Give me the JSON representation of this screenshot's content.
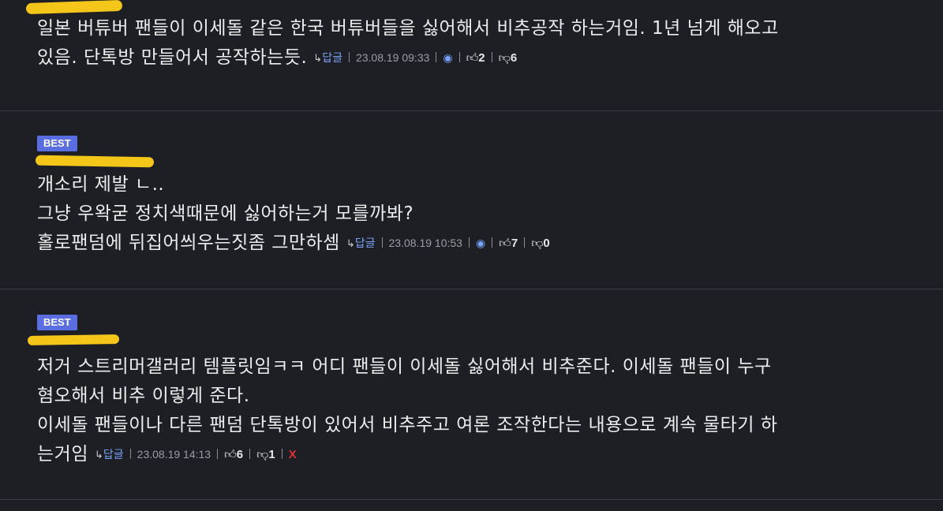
{
  "comments": [
    {
      "best": "",
      "author": "",
      "lines": [
        "일본 버튜버 팬들이 이세돌 같은 한국 버튜버들을 싫어해서 비추공작 하는거임. 1년 넘게 해오고",
        "있음. 단톡방 만들어서 공작하는듯."
      ],
      "reply_label": "답글",
      "timestamp": "23.08.19 09:33",
      "likes": "2",
      "dislikes": "6"
    },
    {
      "best": "BEST",
      "author": "",
      "lines": [
        "개소리 제발 ㄴ..",
        "그냥 우왁굳 정치색때문에 싫어하는거 모를까봐?",
        "홀로팬덤에 뒤집어씌우는짓좀 그만하셈"
      ],
      "reply_label": "답글",
      "timestamp": "23.08.19 10:53",
      "likes": "7",
      "dislikes": "0"
    },
    {
      "best": "BEST",
      "author": "",
      "lines": [
        "저거 스트리머갤러리 템플릿임ㅋㅋ 어디 팬들이 이세돌 싫어해서 비추준다. 이세돌 팬들이 누구",
        "혐오해서 비추 이렇게 준다.",
        "이세돌 팬들이나 다른 팬덤 단톡방이 있어서 비추주고 여론 조작한다는 내용으로 계속 물타기 하",
        "는거임"
      ],
      "reply_label": "답글",
      "timestamp": "23.08.19 14:13",
      "likes": "6",
      "dislikes": "1",
      "delete_label": "X"
    }
  ],
  "icons": {
    "reply": "reply-arrow-icon",
    "bell": "report-bell-icon",
    "like": "thumbs-up-icon",
    "dislike": "thumbs-down-icon"
  },
  "colors": {
    "background": "#1d1f24",
    "best_badge": "#5b6ee1",
    "reply_link": "#7aa2f7",
    "delete": "#e0303a",
    "redaction": "#f5c61a"
  }
}
